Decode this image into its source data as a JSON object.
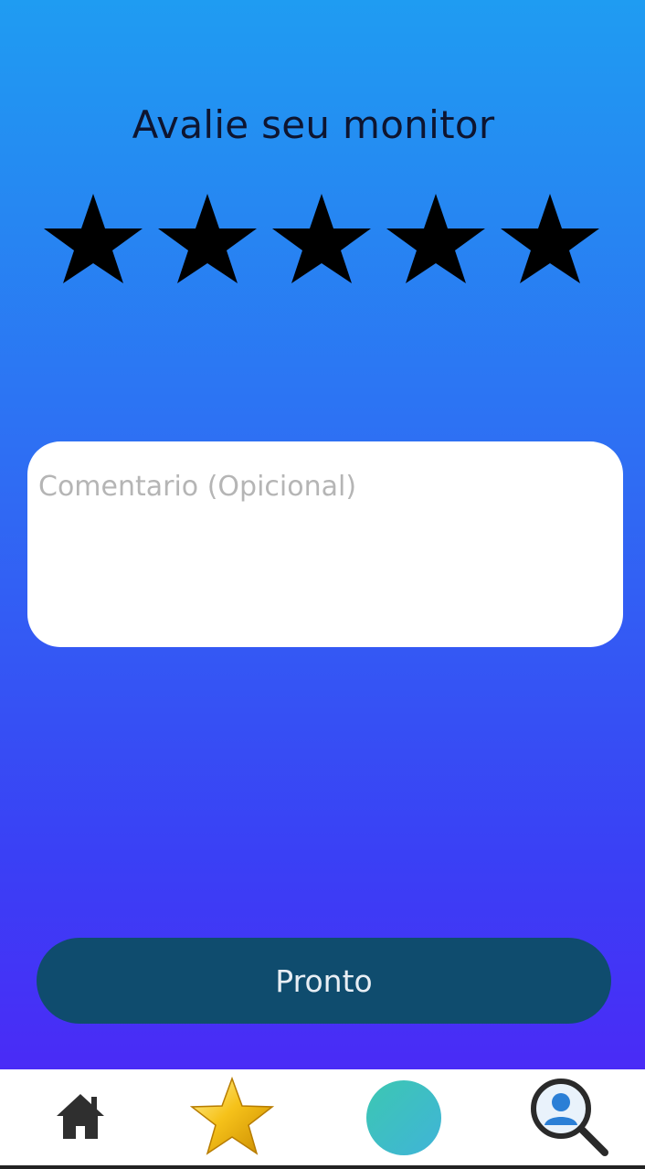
{
  "screen": {
    "title": "Avalie seu monitor"
  },
  "rating": {
    "value": 5,
    "max": 5,
    "star_color": "#000000"
  },
  "comment": {
    "placeholder": "Comentario (Opicional)",
    "value": ""
  },
  "actions": {
    "done_label": "Pronto"
  },
  "bottom_nav": {
    "items": [
      {
        "icon": "home-icon"
      },
      {
        "icon": "star-icon"
      },
      {
        "icon": "circle-icon"
      },
      {
        "icon": "profile-search-icon"
      }
    ]
  },
  "colors": {
    "gradient_top": "#1f9cf2",
    "gradient_bottom": "#4a2bf6",
    "button_bg": "#0f4c6e",
    "nav_circle": "#3cc7b2"
  }
}
